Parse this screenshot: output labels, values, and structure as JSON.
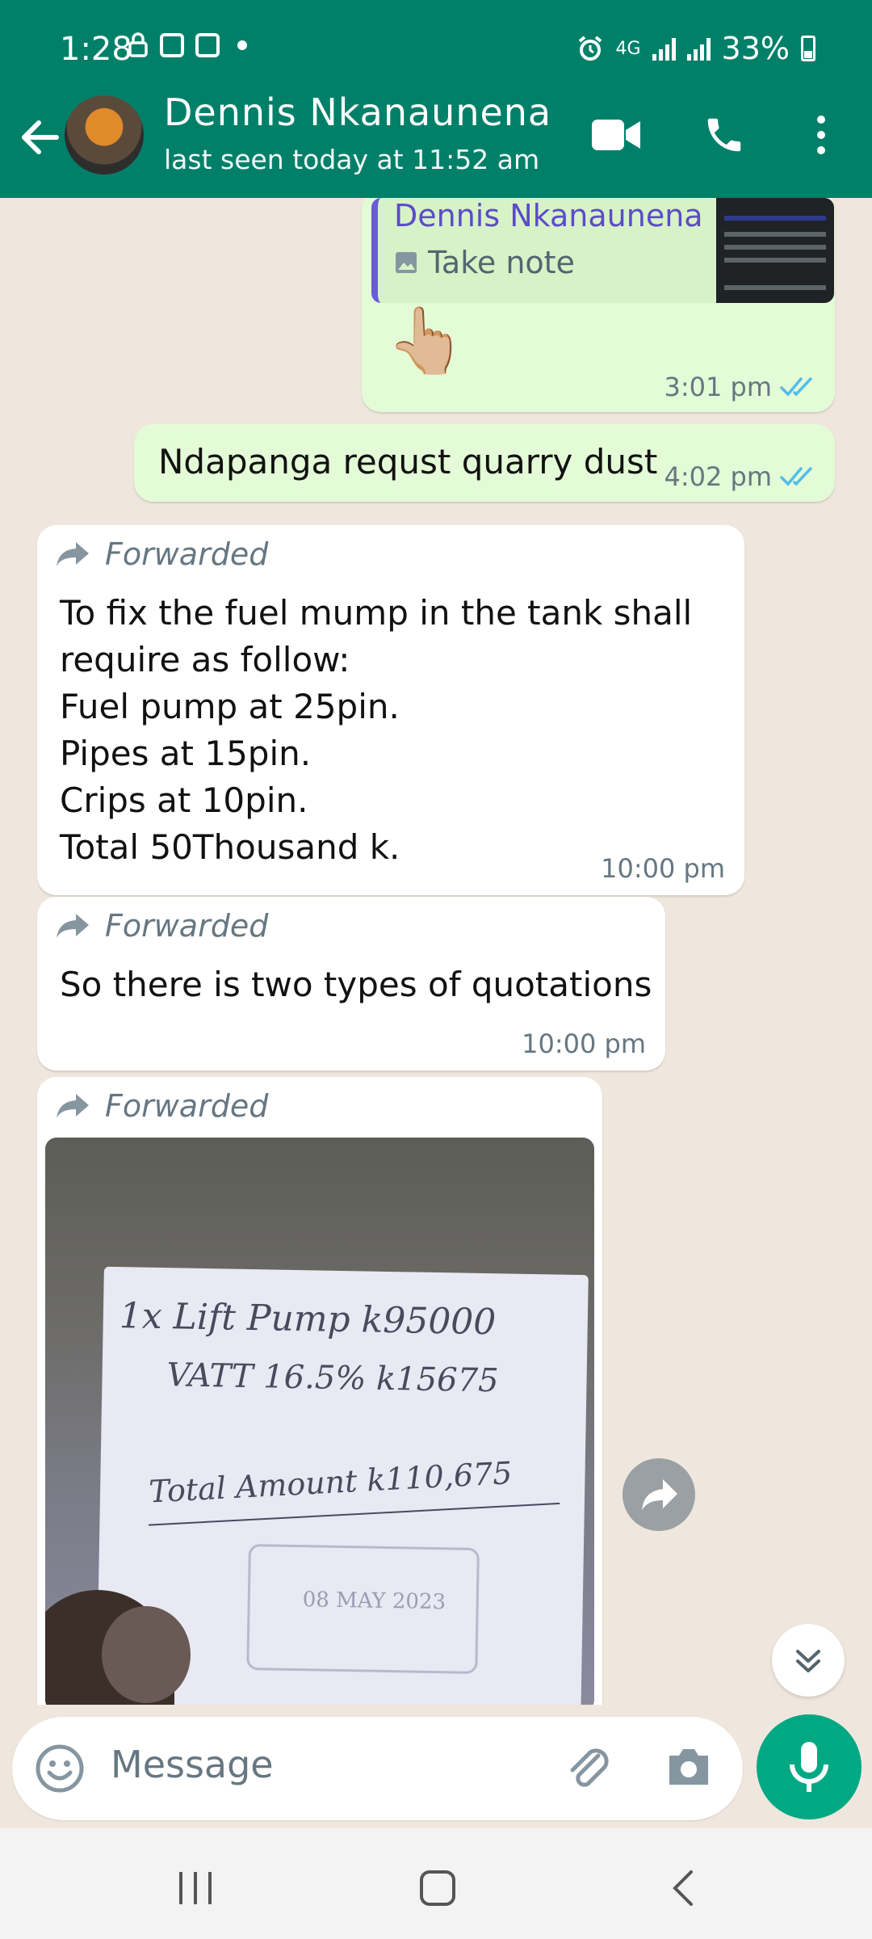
{
  "status_bar": {
    "time": "1:28",
    "network": "4G",
    "battery": "33%"
  },
  "header": {
    "contact_name": "Dennis Nkanaunena",
    "last_seen": "last seen today at 11:52 am"
  },
  "messages": [
    {
      "id": "m1",
      "direction": "outgoing",
      "quote_name": "Dennis Nkanaunena",
      "quote_text": "Take note",
      "emoji": "👆🏼",
      "time": "3:01 pm",
      "read": true
    },
    {
      "id": "m2",
      "direction": "outgoing",
      "text": "Ndapanga requst quarry dust",
      "time": "4:02 pm",
      "read": true
    },
    {
      "id": "m3",
      "direction": "incoming",
      "forwarded_label": "Forwarded",
      "text": "To fix the fuel mump in the tank shall\nrequire as follow:\nFuel pump at 25pin.\nPipes at 15pin.\nCrips at 10pin.\nTotal 50Thousand k.",
      "time": "10:00 pm"
    },
    {
      "id": "m4",
      "direction": "incoming",
      "forwarded_label": "Forwarded",
      "text": "So there is two types of quotations",
      "time": "10:00 pm"
    },
    {
      "id": "m5",
      "direction": "incoming",
      "forwarded_label": "Forwarded",
      "photo_text": {
        "line1": "1x Lift Pump k95000",
        "line2": "VATT 16.5% k15675",
        "line3": "Total Amount k110,675",
        "stamp_date": "08 MAY 2023"
      }
    }
  ],
  "input": {
    "placeholder": "Message"
  },
  "colors": {
    "brand": "#008069",
    "outgoing_bubble": "#e3fbd6",
    "incoming_bubble": "#ffffff",
    "read_ticks": "#53bdeb",
    "mic_button": "#00a884"
  }
}
